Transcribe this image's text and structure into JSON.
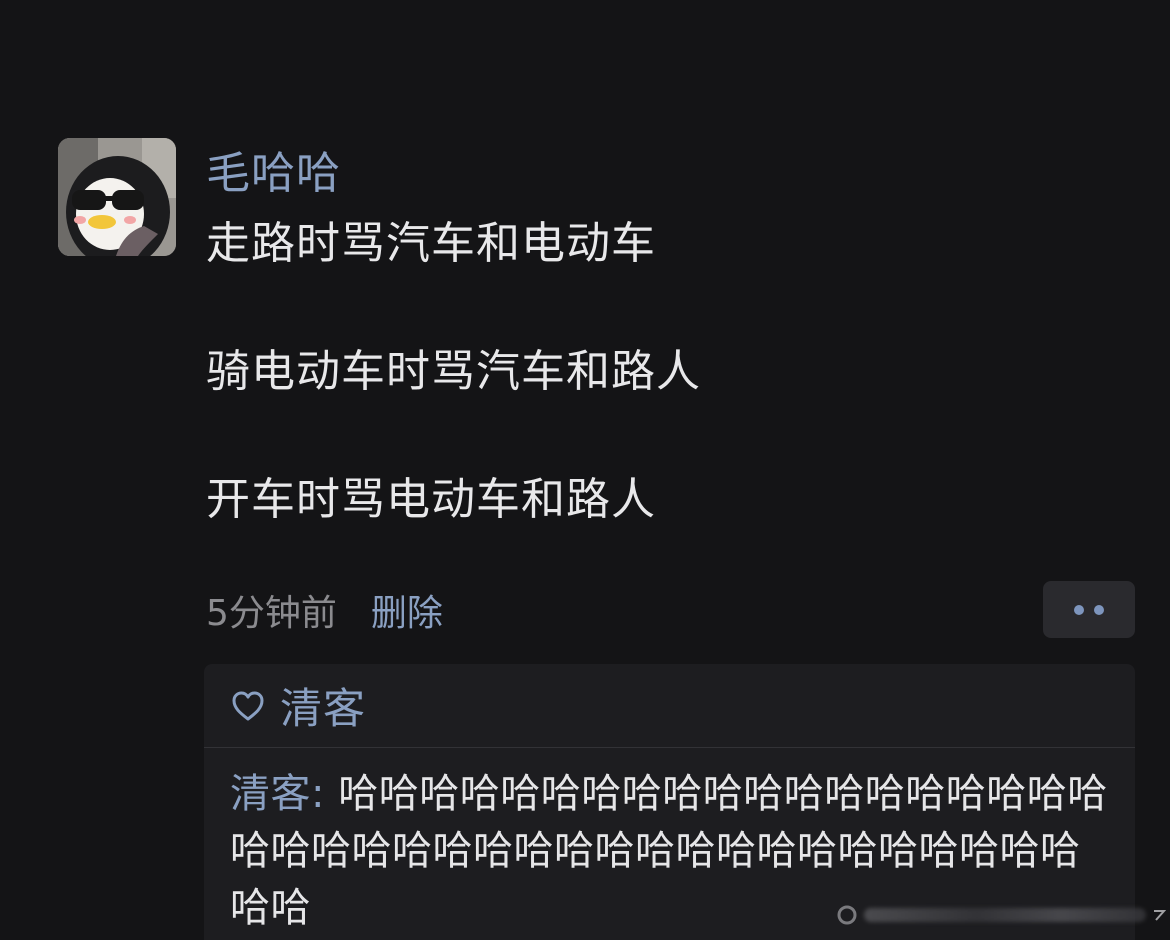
{
  "post": {
    "author": "毛哈哈",
    "lines": [
      "走路时骂汽车和电动车",
      "骑电动车时骂汽车和路人",
      "开车时骂电动车和路人"
    ],
    "time": "5分钟前",
    "delete_label": "删除",
    "more_icon": "more-dots-icon"
  },
  "likes": {
    "icon": "heart-outline-icon",
    "users": [
      "清客"
    ]
  },
  "replies": [
    {
      "author": "清客",
      "separator": ": ",
      "text": "哈哈哈哈哈哈哈哈哈哈哈哈哈哈哈哈哈哈哈哈哈哈哈哈哈哈哈哈哈哈哈哈哈哈哈哈哈哈哈哈哈哈"
    }
  ],
  "colors": {
    "background": "#141416",
    "link": "#8aa0c2",
    "text": "#e8e8ea",
    "muted": "#8b8b8f",
    "panel": "#1d1d20"
  }
}
